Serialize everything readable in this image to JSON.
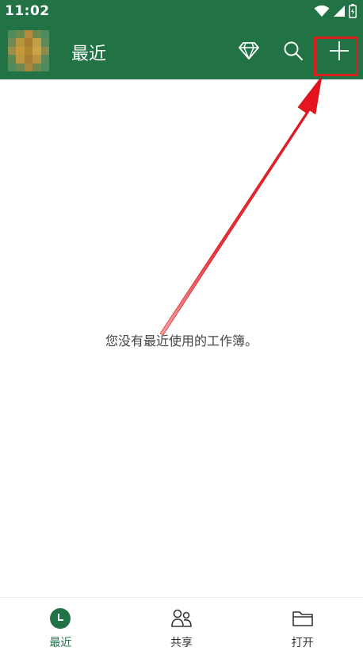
{
  "status_bar": {
    "time": "11:02",
    "icons": [
      "wifi-icon",
      "signal-icon",
      "battery-icon"
    ]
  },
  "app_bar": {
    "title": "最近",
    "actions": [
      "diamond-icon",
      "search-icon",
      "plus-icon"
    ]
  },
  "main": {
    "empty_message": "您没有最近使用的工作簿。"
  },
  "bottom_nav": {
    "items": [
      {
        "label": "最近",
        "icon": "clock-icon",
        "active": true
      },
      {
        "label": "共享",
        "icon": "people-icon",
        "active": false
      },
      {
        "label": "打开",
        "icon": "folder-icon",
        "active": false
      }
    ]
  },
  "colors": {
    "brand": "#217346",
    "highlight": "#d9201c",
    "text": "#444444"
  }
}
